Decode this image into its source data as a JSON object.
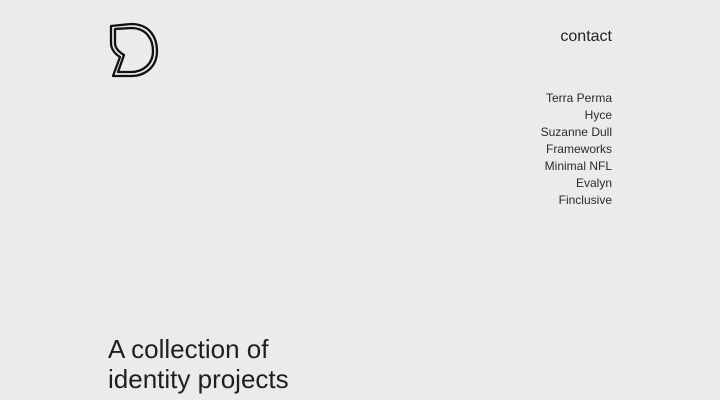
{
  "header": {
    "logo_icon": "speech-bubble-d-logo-icon",
    "contact_label": "contact"
  },
  "projects": {
    "items": [
      {
        "label": "Terra Perma"
      },
      {
        "label": "Hyce"
      },
      {
        "label": "Suzanne Dull"
      },
      {
        "label": "Frameworks"
      },
      {
        "label": "Minimal NFL"
      },
      {
        "label": "Evalyn"
      },
      {
        "label": "Finclusive"
      }
    ]
  },
  "main": {
    "tagline_lines": [
      "A collection of",
      "identity projects"
    ]
  },
  "colors": {
    "background": "#ebebeb",
    "text": "#222222"
  }
}
